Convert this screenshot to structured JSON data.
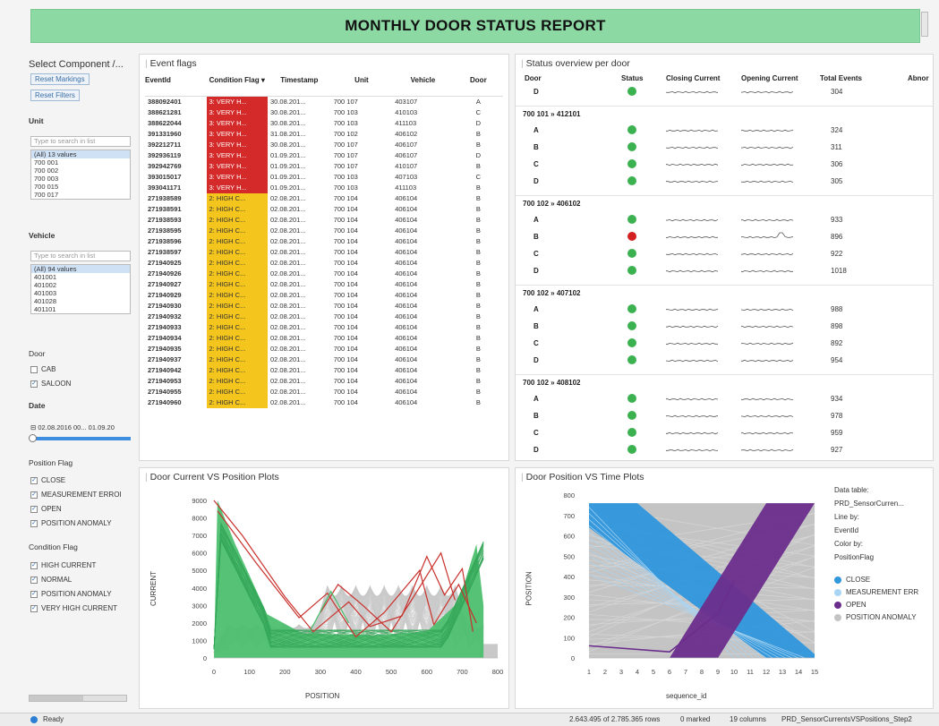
{
  "banner": {
    "title": "MONTHLY DOOR STATUS REPORT"
  },
  "filters": {
    "title": "Select Component /...",
    "reset_markings": "Reset Markings",
    "reset_filters": "Reset Filters",
    "unit_label": "Unit",
    "unit_search": "Type to search in list",
    "unit_items": [
      "(All) 13 values",
      "700 001",
      "700 002",
      "700 003",
      "700 015",
      "700 017"
    ],
    "vehicle_label": "Vehicle",
    "vehicle_search": "Type to search in list",
    "vehicle_items": [
      "(All) 94 values",
      "401001",
      "401002",
      "401003",
      "401028",
      "401101"
    ],
    "door_label": "Door",
    "door_options": [
      {
        "label": "CAB",
        "checked": false
      },
      {
        "label": "SALOON",
        "checked": true
      }
    ],
    "date_label": "Date",
    "date_range": "02.08.2016 00... 01.09.20",
    "position_flag_label": "Position Flag",
    "position_flags": [
      {
        "label": "CLOSE",
        "checked": true
      },
      {
        "label": "MEASUREMENT ERROI",
        "checked": true
      },
      {
        "label": "OPEN",
        "checked": true
      },
      {
        "label": "POSITION ANOMALY",
        "checked": true
      }
    ],
    "condition_flag_label": "Condition Flag",
    "condition_flags": [
      {
        "label": "HIGH CURRENT",
        "checked": true
      },
      {
        "label": "NORMAL",
        "checked": true
      },
      {
        "label": "POSITION ANOMALY",
        "checked": true
      },
      {
        "label": "VERY HIGH CURRENT",
        "checked": true
      }
    ]
  },
  "events": {
    "title": "Event flags",
    "columns": [
      "EventId",
      "Condition Flag",
      "Timestamp",
      "Unit",
      "Vehicle",
      "Door"
    ],
    "rows": [
      [
        "388092401",
        "3: VERY H...",
        "30.08.201...",
        "700 107",
        "403107",
        "A",
        "red"
      ],
      [
        "388621281",
        "3: VERY H...",
        "30.08.201...",
        "700 103",
        "410103",
        "C",
        "red"
      ],
      [
        "388622044",
        "3: VERY H...",
        "30.08.201...",
        "700 103",
        "411103",
        "D",
        "red"
      ],
      [
        "391331960",
        "3: VERY H...",
        "31.08.201...",
        "700 102",
        "406102",
        "B",
        "red"
      ],
      [
        "392212711",
        "3: VERY H...",
        "30.08.201...",
        "700 107",
        "406107",
        "B",
        "red"
      ],
      [
        "392936119",
        "3: VERY H...",
        "01.09.201...",
        "700 107",
        "406107",
        "D",
        "red"
      ],
      [
        "392942769",
        "3: VERY H...",
        "01.09.201...",
        "700 107",
        "410107",
        "B",
        "red"
      ],
      [
        "393015017",
        "3: VERY H...",
        "01.09.201...",
        "700 103",
        "407103",
        "C",
        "red"
      ],
      [
        "393041171",
        "3: VERY H...",
        "01.09.201...",
        "700 103",
        "411103",
        "B",
        "red"
      ],
      [
        "271938589",
        "2: HIGH C...",
        "02.08.201...",
        "700 104",
        "406104",
        "B",
        "yel"
      ],
      [
        "271938591",
        "2: HIGH C...",
        "02.08.201...",
        "700 104",
        "406104",
        "B",
        "yel"
      ],
      [
        "271938593",
        "2: HIGH C...",
        "02.08.201...",
        "700 104",
        "406104",
        "B",
        "yel"
      ],
      [
        "271938595",
        "2: HIGH C...",
        "02.08.201...",
        "700 104",
        "406104",
        "B",
        "yel"
      ],
      [
        "271938596",
        "2: HIGH C...",
        "02.08.201...",
        "700 104",
        "406104",
        "B",
        "yel"
      ],
      [
        "271938597",
        "2: HIGH C...",
        "02.08.201...",
        "700 104",
        "406104",
        "B",
        "yel"
      ],
      [
        "271940925",
        "2: HIGH C...",
        "02.08.201...",
        "700 104",
        "406104",
        "B",
        "yel"
      ],
      [
        "271940926",
        "2: HIGH C...",
        "02.08.201...",
        "700 104",
        "406104",
        "B",
        "yel"
      ],
      [
        "271940927",
        "2: HIGH C...",
        "02.08.201...",
        "700 104",
        "406104",
        "B",
        "yel"
      ],
      [
        "271940929",
        "2: HIGH C...",
        "02.08.201...",
        "700 104",
        "406104",
        "B",
        "yel"
      ],
      [
        "271940930",
        "2: HIGH C...",
        "02.08.201...",
        "700 104",
        "406104",
        "B",
        "yel"
      ],
      [
        "271940932",
        "2: HIGH C...",
        "02.08.201...",
        "700 104",
        "406104",
        "B",
        "yel"
      ],
      [
        "271940933",
        "2: HIGH C...",
        "02.08.201...",
        "700 104",
        "406104",
        "B",
        "yel"
      ],
      [
        "271940934",
        "2: HIGH C...",
        "02.08.201...",
        "700 104",
        "406104",
        "B",
        "yel"
      ],
      [
        "271940935",
        "2: HIGH C...",
        "02.08.201...",
        "700 104",
        "406104",
        "B",
        "yel"
      ],
      [
        "271940937",
        "2: HIGH C...",
        "02.08.201...",
        "700 104",
        "406104",
        "B",
        "yel"
      ],
      [
        "271940942",
        "2: HIGH C...",
        "02.08.201...",
        "700 104",
        "406104",
        "B",
        "yel"
      ],
      [
        "271940953",
        "2: HIGH C...",
        "02.08.201...",
        "700 104",
        "406104",
        "B",
        "yel"
      ],
      [
        "271940955",
        "2: HIGH C...",
        "02.08.201...",
        "700 104",
        "406104",
        "B",
        "yel"
      ],
      [
        "271940960",
        "2: HIGH C...",
        "02.08.201...",
        "700 104",
        "406104",
        "B",
        "yel"
      ]
    ]
  },
  "status": {
    "title": "Status overview per door",
    "columns": [
      "Door",
      "Status",
      "Closing Current",
      "Opening Current",
      "Total Events",
      "Abnor"
    ],
    "top_row": {
      "door": "D",
      "status": "green",
      "total": "304"
    },
    "groups": [
      {
        "name": "700 101 » 412101",
        "doors": [
          {
            "door": "A",
            "status": "green",
            "total": "324"
          },
          {
            "door": "B",
            "status": "green",
            "total": "311"
          },
          {
            "door": "C",
            "status": "green",
            "total": "306"
          },
          {
            "door": "D",
            "status": "green",
            "total": "305"
          }
        ]
      },
      {
        "name": "700 102 » 406102",
        "doors": [
          {
            "door": "A",
            "status": "green",
            "total": "933"
          },
          {
            "door": "B",
            "status": "red",
            "total": "896"
          },
          {
            "door": "C",
            "status": "green",
            "total": "922"
          },
          {
            "door": "D",
            "status": "green",
            "total": "1018"
          }
        ]
      },
      {
        "name": "700 102 » 407102",
        "doors": [
          {
            "door": "A",
            "status": "green",
            "total": "988"
          },
          {
            "door": "B",
            "status": "green",
            "total": "898"
          },
          {
            "door": "C",
            "status": "green",
            "total": "892"
          },
          {
            "door": "D",
            "status": "green",
            "total": "954"
          }
        ]
      },
      {
        "name": "700 102 » 408102",
        "doors": [
          {
            "door": "A",
            "status": "green",
            "total": "934"
          },
          {
            "door": "B",
            "status": "green",
            "total": "978"
          },
          {
            "door": "C",
            "status": "green",
            "total": "959"
          },
          {
            "door": "D",
            "status": "green",
            "total": "927"
          }
        ]
      }
    ]
  },
  "chart_current": {
    "title": "Door Current VS Position Plots",
    "xlabel": "POSITION",
    "ylabel": "CURRENT",
    "xticks": [
      "0",
      "100",
      "200",
      "300",
      "400",
      "500",
      "600",
      "700",
      "800"
    ],
    "yticks": [
      "0",
      "1000",
      "2000",
      "3000",
      "4000",
      "5000",
      "6000",
      "7000",
      "8000",
      "9000"
    ]
  },
  "chart_position": {
    "title": "Door Position VS Time Plots",
    "xlabel": "sequence_id",
    "ylabel": "POSITION",
    "xticks": [
      "1",
      "2",
      "3",
      "4",
      "5",
      "6",
      "7",
      "8",
      "9",
      "10",
      "11",
      "12",
      "13",
      "14",
      "15"
    ],
    "yticks": [
      "0",
      "100",
      "200",
      "300",
      "400",
      "500",
      "600",
      "700",
      "800"
    ],
    "info": [
      "Data table:",
      "PRD_SensorCurren...",
      "Line by:",
      "EventId",
      "Color by:",
      "PositionFlag"
    ],
    "legend": [
      {
        "label": "CLOSE",
        "color": "#2f97dc"
      },
      {
        "label": "MEASUREMENT ERR",
        "color": "#a9d4f2"
      },
      {
        "label": "OPEN",
        "color": "#6b2d8c"
      },
      {
        "label": "POSITION ANOMALY",
        "color": "#c4c4c4"
      }
    ]
  },
  "statusbar": {
    "ready": "Ready",
    "rows": "2.643.495 of 2.785.365 rows",
    "marked": "0 marked",
    "columns": "19 columns",
    "table": "PRD_SensorCurrentsVSPositions_Step2"
  },
  "colors": {
    "red_flag": "#d42a2a",
    "yellow_flag": "#f4c61d",
    "green_status": "#3cb150",
    "red_status": "#d32020",
    "banner": "#8dd9a4"
  }
}
